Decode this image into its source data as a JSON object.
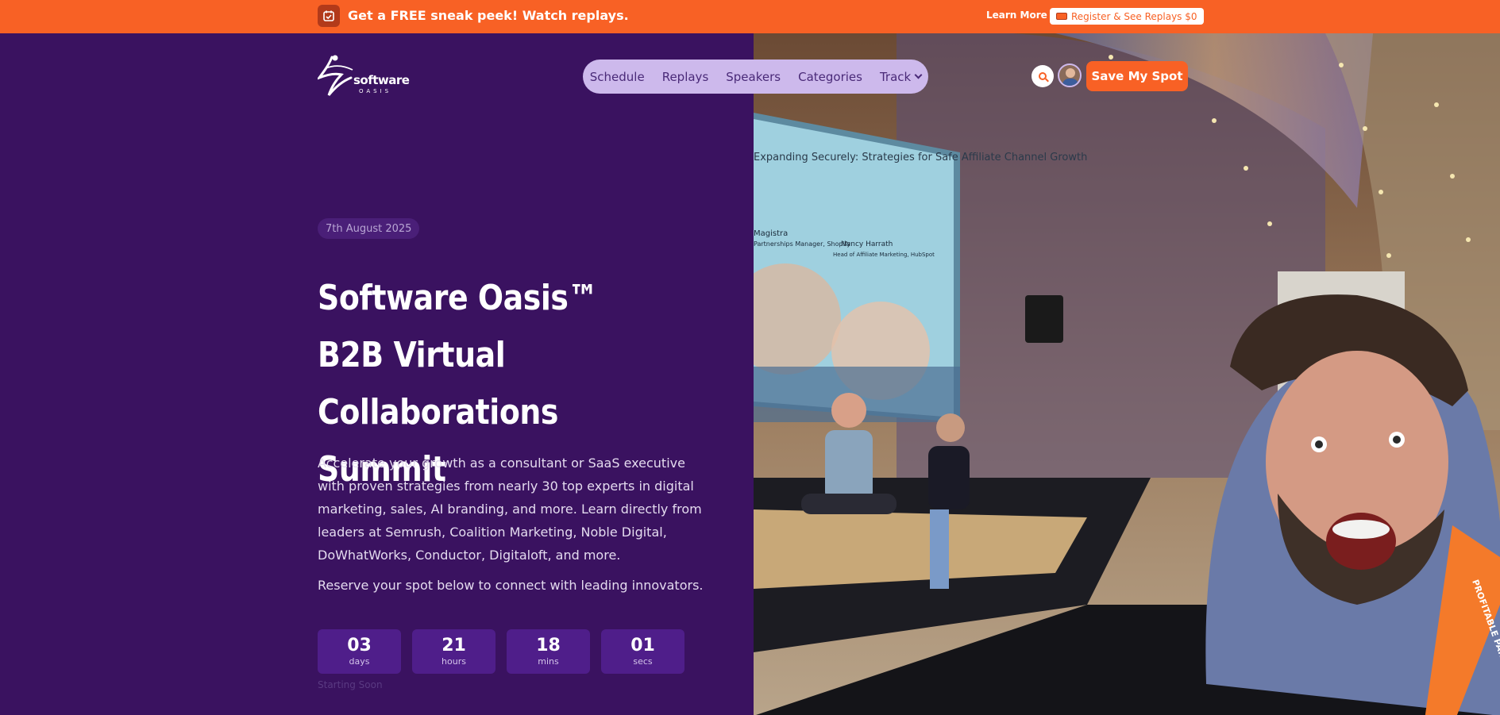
{
  "announcement": {
    "text": "Get a FREE sneak peek! Watch replays.",
    "learn_more": "Learn More",
    "register": "Register & See Replays $0"
  },
  "logo": {
    "word": "software",
    "sub": "OASIS"
  },
  "nav": {
    "items": [
      "Schedule",
      "Replays",
      "Speakers",
      "Categories",
      "Track"
    ],
    "cta": "Save My Spot"
  },
  "hero": {
    "date": "7th August 2025",
    "title": "Software Oasis™ B2B Virtual Collaborations Summit",
    "description": "Accelerate your growth as a consultant or SaaS executive with proven strategies from nearly 30 top experts in digital marketing, sales, AI branding, and more. Learn directly from leaders at Semrush, Coalition Marketing, Noble Digital, DoWhatWorks, Conductor, Digitaloft, and more.",
    "reserve": "Reserve your spot below to connect with leading innovators."
  },
  "countdown": {
    "items": [
      {
        "value": "03",
        "label": "days"
      },
      {
        "value": "21",
        "label": "hours"
      },
      {
        "value": "18",
        "label": "mins"
      },
      {
        "value": "01",
        "label": "secs"
      }
    ],
    "caption": "Starting Soon"
  },
  "photo": {
    "screen_text": "Expanding Securely: Strategies for Safe Affiliate Channel Growth",
    "speaker_a": "Magistra",
    "speaker_a_role": "Partnerships Manager, Shopify",
    "speaker_b": "Nancy Harrath",
    "speaker_b_role": "Head of Affiliate Marketing, HubSpot",
    "lanyard": "PROFITABLE PARTNERSHIPS"
  },
  "colors": {
    "brand_orange": "#f86125",
    "hero_purple": "#3a1260",
    "nav_lilac": "#cdb9ec",
    "countdown_box": "#4f1e8a"
  }
}
